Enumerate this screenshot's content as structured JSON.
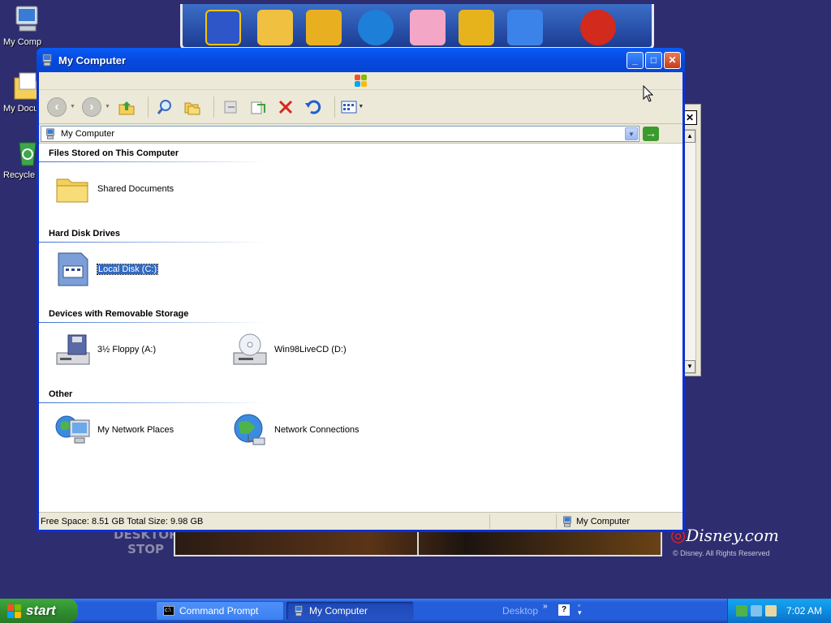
{
  "desktop": {
    "icons": [
      {
        "label": "My Comp"
      },
      {
        "label": "My Docu"
      },
      {
        "label": "Recycle"
      }
    ],
    "wallpaper_text": {
      "desktop_stop": "DESKTOP\nSTOP",
      "disney_logo": "Disney.com",
      "disney_copyright": "© Disney. All Rights Reserved"
    }
  },
  "window": {
    "title": "My Computer",
    "buttons": {
      "minimize": "_",
      "maximize": "□",
      "close": "✕"
    },
    "address": {
      "value": "My Computer"
    },
    "groups": [
      {
        "heading": "Files Stored on This Computer",
        "items": [
          {
            "label": "Shared Documents",
            "icon": "folder-icon"
          }
        ]
      },
      {
        "heading": "Hard Disk Drives",
        "items": [
          {
            "label": "Local Disk (C:)",
            "icon": "hard-disk-icon",
            "selected": true
          }
        ]
      },
      {
        "heading": "Devices with Removable Storage",
        "items": [
          {
            "label": "3½ Floppy (A:)",
            "icon": "floppy-drive-icon"
          },
          {
            "label": "Win98LiveCD (D:)",
            "icon": "cd-drive-icon"
          }
        ]
      },
      {
        "heading": "Other",
        "items": [
          {
            "label": "My Network Places",
            "icon": "network-places-icon"
          },
          {
            "label": "Network Connections",
            "icon": "network-connections-icon"
          }
        ]
      }
    ],
    "status": {
      "free_space": "Free Space: 8.51 GB Total Size: 9.98 GB",
      "location": "My Computer"
    }
  },
  "taskbar": {
    "start_label": "start",
    "tasks": [
      {
        "label": "Command Prompt",
        "active": false
      },
      {
        "label": "My Computer",
        "active": true
      }
    ],
    "desktop_toolbar": "Desktop",
    "clock": "7:02 AM"
  },
  "colors": {
    "titlebar": "#0a5cf5",
    "desktop_bg": "#2e2d6f",
    "selection": "#316ac5",
    "start_green": "#3fa83f"
  }
}
